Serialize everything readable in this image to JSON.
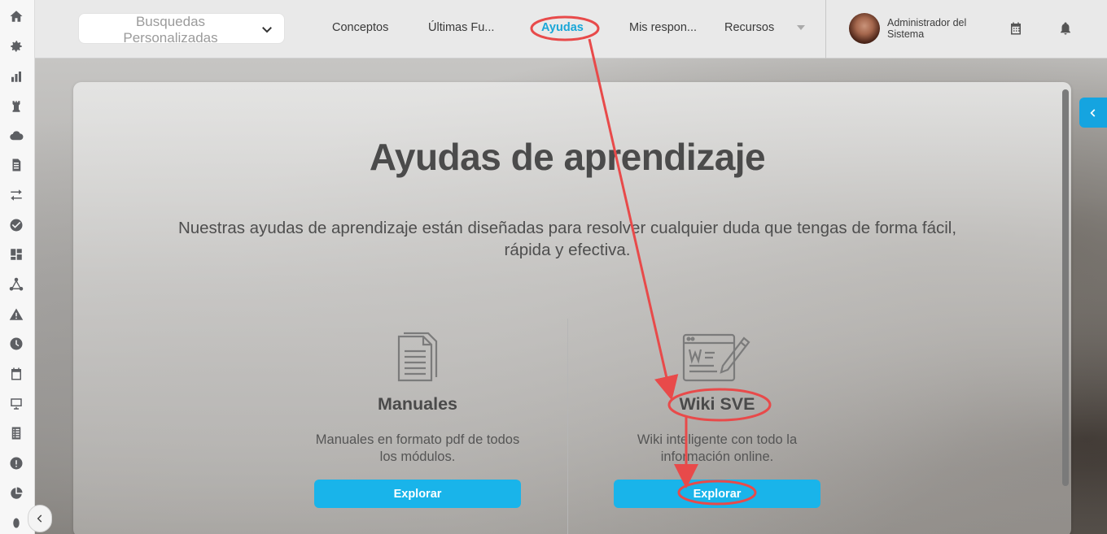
{
  "topbar": {
    "search_select": {
      "value": "Busquedas Personalizadas"
    },
    "nav": [
      {
        "label": "Conceptos"
      },
      {
        "label": "Últimas Fu..."
      },
      {
        "label": "Ayudas"
      },
      {
        "label": "Mis respon..."
      },
      {
        "label": "Recursos"
      }
    ],
    "user": {
      "name": "Administrador del Sistema"
    }
  },
  "main": {
    "title": "Ayudas de aprendizaje",
    "subtitle": "Nuestras ayudas de aprendizaje están diseñadas para resolver cualquier duda que tengas de forma fácil, rápida y efectiva.",
    "resources": [
      {
        "title": "Manuales",
        "description": "Manuales en formato pdf de todos los módulos.",
        "button": "Explorar",
        "icon": "document-icon"
      },
      {
        "title": "Wiki SVE",
        "description": "Wiki inteligente con todo la información online.",
        "button": "Explorar",
        "icon": "wiki-edit-icon"
      }
    ]
  },
  "sidebar": {
    "icons": [
      "home-icon",
      "gear-icon",
      "bar-chart-icon",
      "chess-rook-icon",
      "cloud-icon",
      "document-icon",
      "transfer-arrows-icon",
      "check-circle-icon",
      "dashboard-icon",
      "network-icon",
      "warning-icon",
      "clock-icon",
      "calendar-icon",
      "presentation-icon",
      "list-icon",
      "alert-circle-icon",
      "pie-chart-icon"
    ]
  },
  "colors": {
    "accent": "#19b4ea",
    "annotation": "#e84a4a",
    "active_nav": "#1aa7d8"
  }
}
